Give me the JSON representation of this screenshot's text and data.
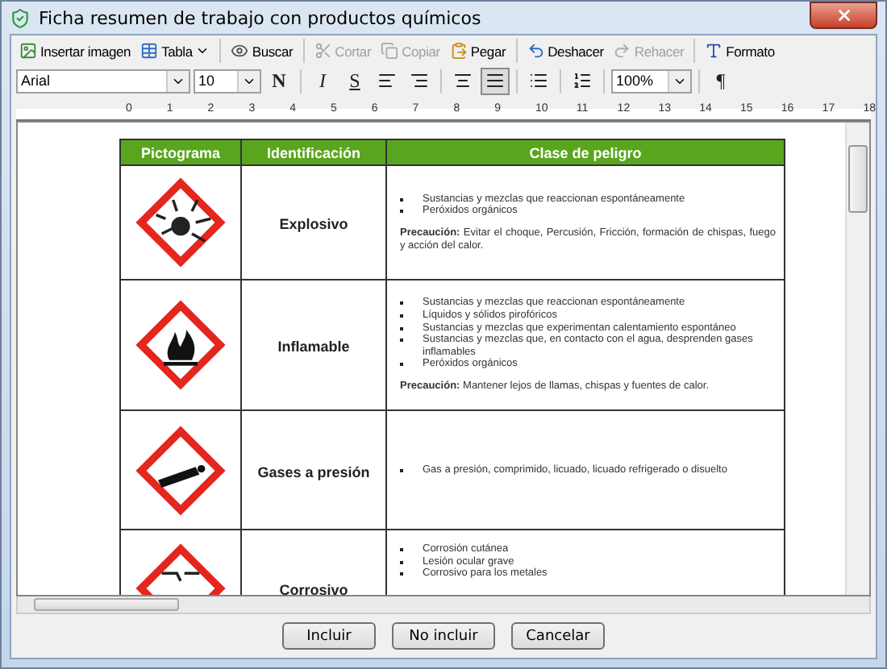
{
  "window": {
    "title": "Ficha resumen de trabajo con productos químicos"
  },
  "toolbar": {
    "groups": [
      [
        {
          "kind": "image",
          "label": "Insertar imagen",
          "disabled": false
        },
        {
          "kind": "table",
          "label": "Tabla",
          "disabled": false,
          "dropdown": true
        }
      ],
      [
        {
          "kind": "find",
          "label": "Buscar",
          "disabled": false
        }
      ],
      [
        {
          "kind": "cut",
          "label": "Cortar",
          "disabled": true
        },
        {
          "kind": "copy",
          "label": "Copiar",
          "disabled": true
        },
        {
          "kind": "paste",
          "label": "Pegar",
          "disabled": false
        }
      ],
      [
        {
          "kind": "undo",
          "label": "Deshacer",
          "disabled": false
        },
        {
          "kind": "redo",
          "label": "Rehacer",
          "disabled": true
        }
      ],
      [
        {
          "kind": "format",
          "label": "Formato",
          "disabled": false
        }
      ]
    ]
  },
  "format_bar": {
    "font": "Arial",
    "size": "10",
    "zoom": "100%",
    "groups": [
      [
        {
          "kind": "bold",
          "label": "N",
          "selected": false
        }
      ],
      [
        {
          "kind": "italic",
          "label": "I",
          "selected": false
        },
        {
          "kind": "underline",
          "label": "S",
          "selected": false
        },
        {
          "kind": "align_left",
          "selected": false
        },
        {
          "kind": "align_right",
          "selected": false
        }
      ],
      [
        {
          "kind": "align_center",
          "selected": false
        },
        {
          "kind": "justify",
          "selected": true
        }
      ],
      [
        {
          "kind": "bullets",
          "selected": false
        }
      ],
      [
        {
          "kind": "numbering",
          "selected": false
        }
      ]
    ],
    "pilcrow": "¶"
  },
  "ruler": {
    "marks": [
      "0",
      "1",
      "2",
      "3",
      "4",
      "5",
      "6",
      "7",
      "8",
      "9",
      "10",
      "11",
      "12",
      "13",
      "14",
      "15",
      "16",
      "17",
      "18"
    ]
  },
  "table": {
    "columns": [
      "Pictograma",
      "Identificación",
      "Clase de peligro"
    ],
    "rows": [
      {
        "kind": "explosive",
        "identification": "Explosivo",
        "hazards": [
          "Sustancias y mezclas que reaccionan espontáneamente",
          "Peróxidos orgánicos"
        ],
        "precaution": "**Precaución:** Evitar el choque, Percusión, Fricción, formación de chispas, fuego y acción del calor."
      },
      {
        "kind": "flame",
        "identification": "Inflamable",
        "hazards": [
          "Sustancias y mezclas que reaccionan espontáneamente",
          "Líquidos y sólidos pirofóricos",
          "Sustancias y mezclas que experimentan calentamiento espontáneo",
          "Sustancias y mezclas que, en contacto con el agua, desprenden gases inflamables",
          "Peróxidos orgánicos"
        ],
        "precaution": "**Precaución:** Mantener lejos de llamas, chispas y fuentes de calor."
      },
      {
        "kind": "gas_cylinder",
        "identification": "Gases a presión",
        "hazards": [
          "Gas a presión, comprimido, licuado, licuado refrigerado o disuelto"
        ]
      },
      {
        "kind": "corrosion",
        "identification": "Corrosivo",
        "hazards": [
          "Corrosión cutánea",
          "Lesión ocular grave",
          "Corrosivo para los metales"
        ]
      }
    ]
  },
  "buttons": [
    "Incluir",
    "No incluir",
    "Cancelar"
  ]
}
